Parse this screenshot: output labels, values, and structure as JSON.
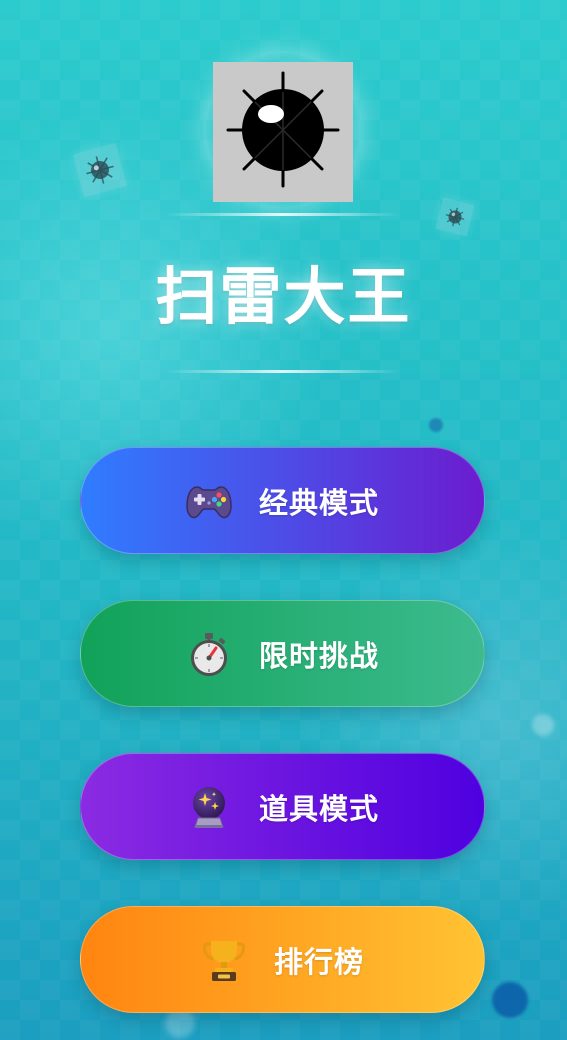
{
  "app": {
    "title": "扫雷大王",
    "logo_icon": "mine-icon"
  },
  "menu": {
    "items": [
      {
        "label": "经典模式",
        "icon": "gamepad-icon",
        "colors": [
          "#2f7dff",
          "#6b1ccf"
        ]
      },
      {
        "label": "限时挑战",
        "icon": "stopwatch-icon",
        "colors": [
          "#11a259",
          "#3dbb8f"
        ]
      },
      {
        "label": "道具模式",
        "icon": "crystal-ball-icon",
        "colors": [
          "#8b2be2",
          "#4e00df"
        ]
      },
      {
        "label": "排行榜",
        "icon": "trophy-icon",
        "colors": [
          "#ff8510",
          "#ffc333"
        ]
      }
    ]
  },
  "theme": {
    "background_top": "#2ccbcd",
    "background_bottom": "#1b9ec0",
    "logo_tile": "#c9c9c9",
    "text": "#ffffff"
  }
}
